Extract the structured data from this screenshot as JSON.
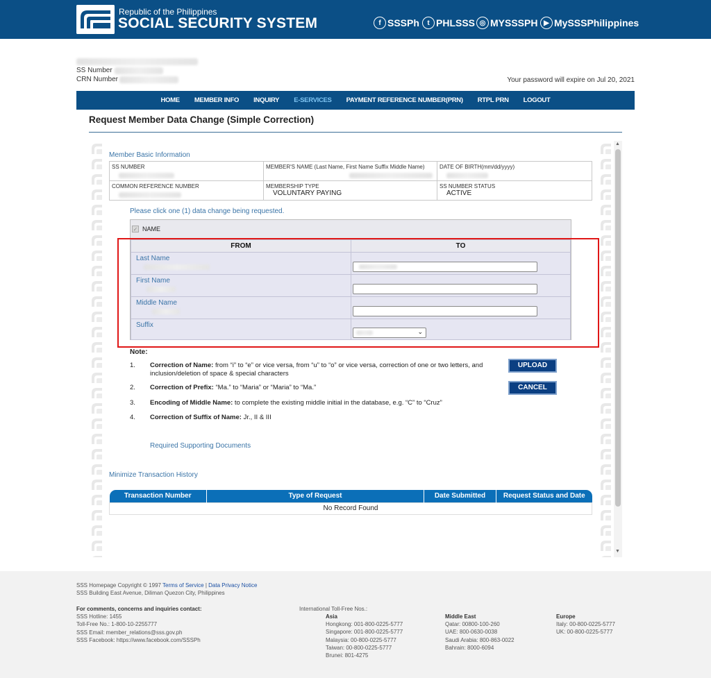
{
  "header": {
    "republic": "Republic of the Philippines",
    "agency": "SOCIAL SECURITY SYSTEM",
    "social": [
      {
        "icon": "facebook-icon",
        "glyph": "f",
        "label": "SSSPh"
      },
      {
        "icon": "twitter-icon",
        "glyph": "t",
        "label": "PHLSSS"
      },
      {
        "icon": "instagram-icon",
        "glyph": "◎",
        "label": "MYSSSPH"
      },
      {
        "icon": "youtube-icon",
        "glyph": "▶",
        "label": "MySSSPhilippines"
      }
    ]
  },
  "member_info": {
    "ss_label": "SS Number",
    "crn_label": "CRN Number",
    "password_notice": "Your password will expire on Jul 20, 2021"
  },
  "nav": [
    "HOME",
    "MEMBER INFO",
    "INQUIRY",
    "E-SERVICES",
    "PAYMENT REFERENCE NUMBER(PRN)",
    "RTPL PRN",
    "LOGOUT"
  ],
  "nav_active": "E-SERVICES",
  "page_title": "Request Member Data Change (Simple Correction)",
  "basic": {
    "heading": "Member Basic Information",
    "ss_number_label": "SS NUMBER",
    "member_name_label": "MEMBER'S NAME (Last Name, First Name Suffix Middle Name)",
    "dob_label": "DATE OF BIRTH(mm/dd/yyyy)",
    "crn_label": "COMMON REFERENCE NUMBER",
    "membership_type_label": "MEMBERSHIP TYPE",
    "membership_type": "VOLUNTARY PAYING",
    "status_label": "SS NUMBER STATUS",
    "status": "ACTIVE"
  },
  "data_change": {
    "prompt": "Please click one (1) data change being requested.",
    "option": "NAME",
    "from_header": "FROM",
    "to_header": "TO",
    "fields": [
      "Last Name",
      "First Name",
      "Middle Name",
      "Suffix"
    ]
  },
  "notes": {
    "title": "Note:",
    "items": [
      {
        "num": "1.",
        "bold": "Correction of Name:",
        "text": " from “i” to “e” or vice versa, from “u” to “o” or vice versa, correction of one or two letters, and inclusion/deletion of space & special characters"
      },
      {
        "num": "2.",
        "bold": "Correction of Prefix:",
        "text": " “Ma.” to “Maria” or “Maria” to “Ma.”"
      },
      {
        "num": "3.",
        "bold": "Encoding of Middle Name:",
        "text": " to complete the existing middle initial in the database, e.g. “C” to “Cruz”"
      },
      {
        "num": "4.",
        "bold": "Correction of Suffix of Name:",
        "text": " Jr., II & III"
      }
    ],
    "supporting_docs": "Required Supporting Documents"
  },
  "buttons": {
    "upload": "UPLOAD",
    "cancel": "CANCEL"
  },
  "history": {
    "toggle": "Minimize Transaction History",
    "columns": [
      "Transaction Number",
      "Type of Request",
      "Date Submitted",
      "Request Status and Date"
    ],
    "empty": "No Record Found"
  },
  "footer": {
    "copyright": "SSS Homepage Copyright © 1997",
    "terms": "Terms of Service",
    "separator": " | ",
    "privacy": "Data Privacy Notice",
    "address": "SSS Building East Avenue, Diliman Quezon City, Philippines",
    "contact_title": "For comments, concerns and inquiries contact:",
    "contacts": [
      "SSS Hotline: 1455",
      "Toll-Free No.: 1-800-10-2255777",
      "SSS Email: member_relations@sss.gov.ph",
      "SSS Facebook: https://www.facebook.com/SSSPh"
    ],
    "intl_title": "International Toll-Free Nos.:",
    "regions": [
      {
        "name": "Asia",
        "lines": [
          "Hongkong: 001-800-0225-5777",
          "Singapore: 001-800-0225-5777",
          "Malaysia: 00-800-0225-5777",
          "Taiwan: 00-800-0225-5777",
          "Brunei: 801-4275"
        ]
      },
      {
        "name": "Middle East",
        "lines": [
          "Qatar: 00800-100-260",
          "UAE: 800-0630-0038",
          "Saudi Arabia: 800-863-0022",
          "Bahrain: 8000-6094"
        ]
      },
      {
        "name": "Europe",
        "lines": [
          "Italy: 00-800-0225-5777",
          "UK: 00-800-0225-5777"
        ]
      }
    ]
  },
  "colors": {
    "brand": "#0b4f86",
    "active_nav": "#7ec4f2",
    "link": "#3a74a7",
    "highlight": "#e01616",
    "button": "#0b3f82"
  }
}
